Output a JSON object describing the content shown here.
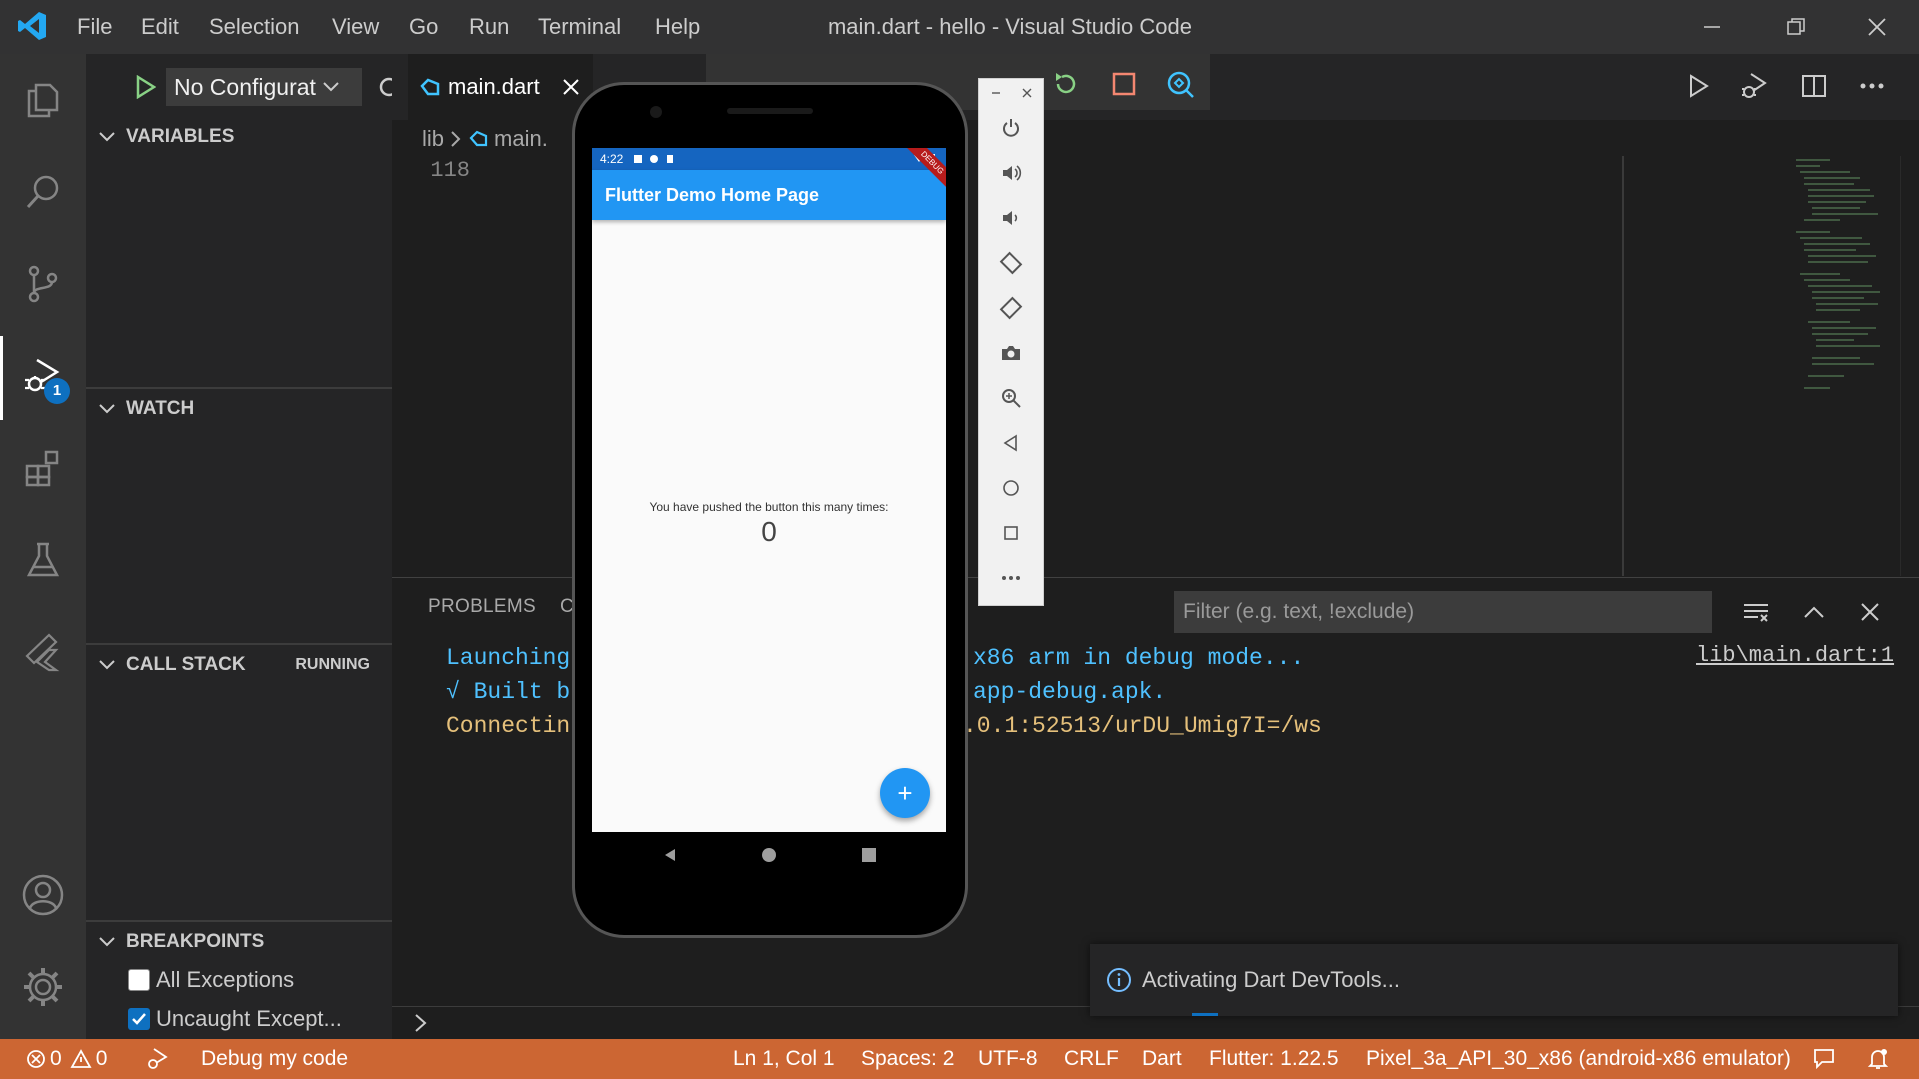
{
  "window": {
    "title": "main.dart - hello - Visual Studio Code",
    "menu": [
      "File",
      "Edit",
      "Selection",
      "View",
      "Go",
      "Run",
      "Terminal",
      "Help"
    ]
  },
  "activity_bar": {
    "items": [
      "explorer-icon",
      "search-icon",
      "source-control-icon",
      "run-debug-icon",
      "extensions-icon",
      "testing-icon",
      "flutter-icon"
    ],
    "debug_badge": "1",
    "bottom": [
      "accounts-icon",
      "manage-gear-icon"
    ]
  },
  "sidebar": {
    "config_label": "No Configurat",
    "sections": {
      "variables": "VARIABLES",
      "watch": "WATCH",
      "call_stack": "CALL STACK",
      "call_stack_status": "RUNNING",
      "breakpoints": "BREAKPOINTS"
    },
    "breakpoints": [
      {
        "label": "All Exceptions",
        "checked": false
      },
      {
        "label": "Uncaught Except...",
        "checked": true
      }
    ]
  },
  "editor": {
    "tab_label": "main.dart",
    "breadcrumb_root": "lib",
    "breadcrumb_file": "main.",
    "line_number": "118"
  },
  "panel": {
    "tab_problems": "PROBLEMS",
    "tab_partial": "C",
    "filter_placeholder": "Filter (e.g. text, !exclude)",
    "console": [
      {
        "left": "Launching",
        "right": "x86 arm in debug mode...",
        "color": "#4fc1ff"
      },
      {
        "left": "√ Built b",
        "right": "app-debug.apk.",
        "color": "#4fc1ff"
      },
      {
        "left": "Connectin",
        "right": ".0.1:52513/urDU_Umig7I=/ws",
        "color": "#e5c07b"
      }
    ],
    "link": "lib\\main.dart:1"
  },
  "notification": {
    "text": "Activating Dart DevTools..."
  },
  "phone": {
    "time": "4:22",
    "app_title": "Flutter Demo Home Page",
    "counter_label": "You have pushed the button this many times:",
    "counter_value": "0",
    "fab_label": "+",
    "ribbon": "DEBUG"
  },
  "statusbar": {
    "errors": "0",
    "warnings": "0",
    "debug_label": "Debug my code",
    "position": "Ln 1, Col 1",
    "spaces": "Spaces: 2",
    "encoding": "UTF-8",
    "eol": "CRLF",
    "language": "Dart",
    "flutter": "Flutter: 1.22.5",
    "device": "Pixel_3a_API_30_x86 (android-x86 emulator)"
  },
  "colors": {
    "accent": "#0e70c0",
    "statusbar": "#cc6633",
    "debug_green": "#89d185",
    "stop_red": "#f48771"
  }
}
